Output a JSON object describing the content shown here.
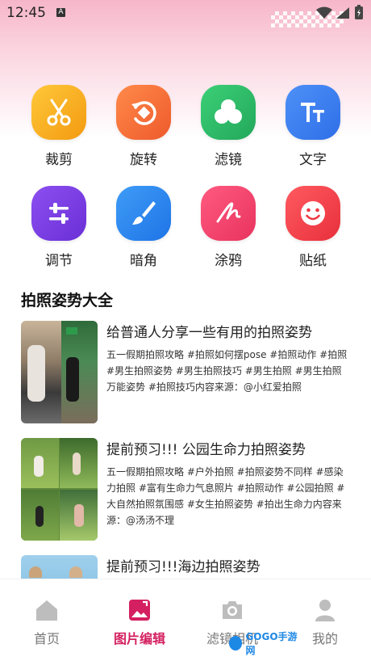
{
  "status": {
    "time": "12:45",
    "notif": "A"
  },
  "tools": [
    {
      "label": "裁剪",
      "icon": "scissors-icon",
      "color": "#f7a51c"
    },
    {
      "label": "旋转",
      "icon": "rotate-icon",
      "color": "#f26a38"
    },
    {
      "label": "滤镜",
      "icon": "filter-icon",
      "color": "#2eb866"
    },
    {
      "label": "文字",
      "icon": "text-icon",
      "color": "#3b82f6"
    },
    {
      "label": "调节",
      "icon": "adjust-icon",
      "color": "#7b3fe4"
    },
    {
      "label": "暗角",
      "icon": "brush-icon",
      "color": "#2c8af4"
    },
    {
      "label": "涂鸦",
      "icon": "doodle-icon",
      "color": "#f0426e"
    },
    {
      "label": "贴纸",
      "icon": "sticker-icon",
      "color": "#f0424e"
    }
  ],
  "section": {
    "title": "拍照姿势大全"
  },
  "articles": [
    {
      "title": "给普通人分享一些有用的拍照姿势",
      "desc": "五一假期拍照攻略 #拍照如何摆pose #拍照动作 #拍照 #男生拍照姿势 #男生拍照技巧 #男生拍照 #男生拍照万能姿势 #拍照技巧内容来源：@小红爱拍照"
    },
    {
      "title": "提前预习!!! 公园生命力拍照姿势",
      "desc": "五一假期拍照攻略 #户外拍照 #拍照姿势不同样 #感染力拍照 #富有生命力气息照片 #拍照动作 #公园拍照 #大自然拍照氛围感 #女生拍照姿势 #拍出生命力内容来源：@汤汤不理"
    },
    {
      "title": "提前预习!!!海边拍照姿势",
      "desc": ""
    }
  ],
  "tabs": [
    {
      "label": "首页",
      "icon": "home-icon",
      "active": false
    },
    {
      "label": "图片编辑",
      "icon": "image-edit-icon",
      "active": true
    },
    {
      "label": "滤镜相机",
      "icon": "camera-icon",
      "active": false
    },
    {
      "label": "我的",
      "icon": "profile-icon",
      "active": false
    }
  ],
  "watermark": {
    "text": "GOGO手游网"
  },
  "colors": {
    "accent": "#d42060"
  }
}
